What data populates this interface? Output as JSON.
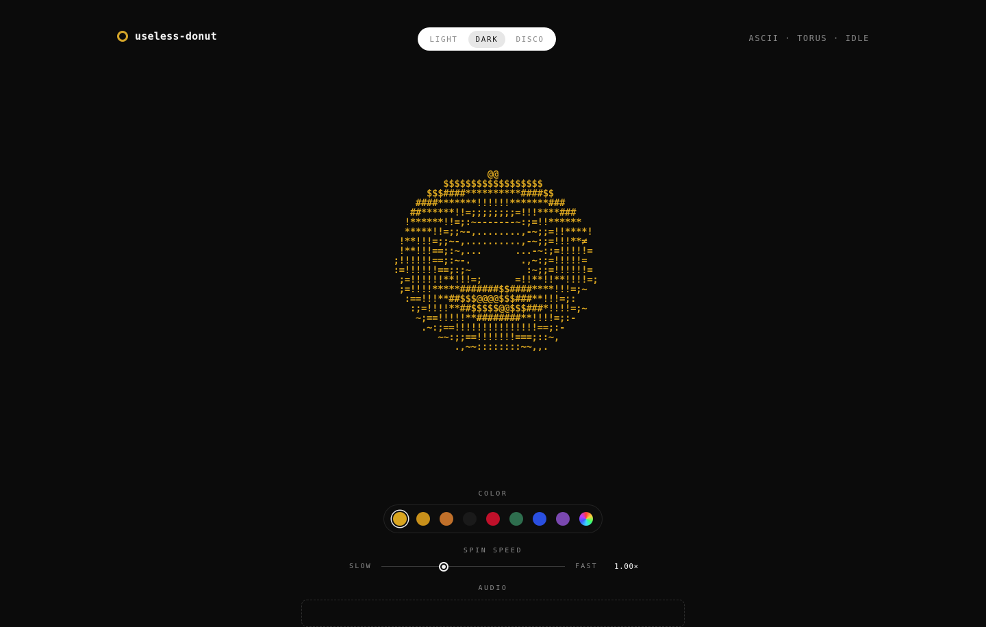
{
  "brand": {
    "name": "useless-donut",
    "accent": "#d4a52a"
  },
  "theme": {
    "options": [
      "LIGHT",
      "DARK",
      "DISCO"
    ],
    "selected": "DARK"
  },
  "meta": {
    "text": "ASCII · TORUS · IDLE"
  },
  "donut": {
    "color": "#d9a520",
    "lines": [
      "                    @@                    ",
      "            $$$$$$$$$$$$$$$$$$            ",
      "         $$$####**********####$$          ",
      "       ####*******!!!!!!*******###        ",
      "      ##******!!=;;;;;;;;=!!!****###      ",
      "     !******!!=;:~-------~:;=!!******     ",
      "     *****!!=;;~-,........,-~;;=!!****!   ",
      "    !**!!!=;;~-,..........,-~;;=!!!**≠    ",
      "    !**!!!==;:~,...      ...-~:;=!!!!!=   ",
      "   ;!!!!!!==;:~-.         .,~:;=!!!!!=    ",
      "   :=!!!!!!==;:;~          :~;;=!!!!!!=   ",
      "    ;=!!!!!!**!!!=;      =!!**!!**!!!!=;  ",
      "    ;=!!!!*****#######$$####****!!!=;~    ",
      "     :==!!!**##$$$@@@@$$$###**!!!=;:      ",
      "      :;=!!!!**##$$$$$@@$$$###*!!!!=;~    ",
      "       ~;==!!!!!**########**!!!!=;:-      ",
      "        .~:;==!!!!!!!!!!!!!!!==;:-        ",
      "           ~~:;;==!!!!!!!===;::~,         ",
      "              .,~~::::::::~~,,.           "
    ]
  },
  "color_picker": {
    "label": "COLOR",
    "selected_index": 0,
    "swatches": [
      "#d9a520",
      "#c8901a",
      "#c0702a",
      "#1a1a1a",
      "#c0102a",
      "#2e6e4e",
      "#2a4fe0",
      "#7a48b0",
      "rainbow"
    ]
  },
  "spin_speed": {
    "label": "SPIN SPEED",
    "min_label": "SLOW",
    "max_label": "FAST",
    "value_text": "1.00×",
    "fraction": 0.34
  },
  "audio": {
    "label": "AUDIO"
  }
}
